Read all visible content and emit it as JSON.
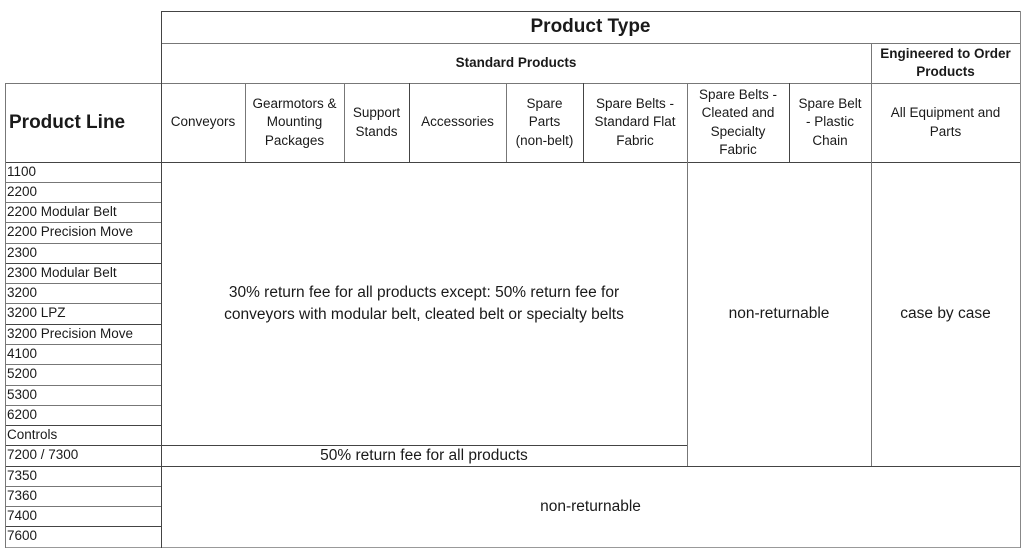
{
  "header": {
    "title": "Product Type",
    "standard_group": "Standard Products",
    "eto_group": "Engineered to Order Products",
    "product_line_label": "Product Line",
    "columns": [
      "Conveyors",
      "Gearmotors & Mounting Packages",
      "Support Stands",
      "Accessories",
      "Spare Parts (non-belt)",
      "Spare Belts - Standard Flat Fabric",
      "Spare Belts - Cleated and Specialty Fabric",
      "Spare Belt - Plastic Chain",
      "All Equipment and Parts"
    ]
  },
  "product_lines": [
    "1100",
    "2200",
    "2200 Modular Belt",
    "2200 Precision Move",
    "2300",
    "2300 Modular Belt",
    "3200",
    "3200 LPZ",
    "3200 Precision Move",
    "4100",
    "5200",
    "5300",
    "6200",
    "Controls",
    "7200 / 7300",
    "7350",
    "7360",
    "7400",
    "7600"
  ],
  "policies": {
    "standard_main_line1": "30% return fee for all products except:  50% return fee for",
    "standard_main_line2": "conveyors with modular belt, cleated belt or specialty belts",
    "standard_7200": "50% return fee for all products",
    "spare_belts": "non-returnable",
    "engineered": "case by case",
    "lower_lines": "non-returnable"
  }
}
